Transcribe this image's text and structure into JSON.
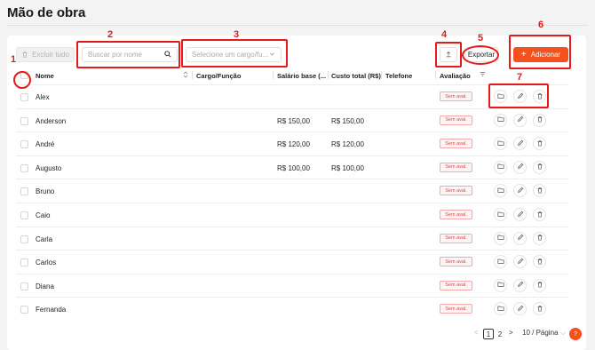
{
  "page": {
    "title": "Mão de obra"
  },
  "toolbar": {
    "delete_label": "Excluir tudo",
    "search_placeholder": "Buscar por nome",
    "role_placeholder": "Selecione um cargo/fu...",
    "export_label": "Exportar",
    "add_label": "Adicionar"
  },
  "table": {
    "columns": [
      "Nome",
      "Cargo/Função",
      "Salário base (...",
      "Custo total (R$)",
      "Telefone",
      "Avaliação"
    ],
    "rows": [
      {
        "name": "Alex",
        "role": "",
        "salary": "",
        "cost": "",
        "phone": "",
        "rating": "Sem aval."
      },
      {
        "name": "Anderson",
        "role": "",
        "salary": "R$ 150,00",
        "cost": "R$ 150,00",
        "phone": "",
        "rating": "Sem aval."
      },
      {
        "name": "André",
        "role": "",
        "salary": "R$ 120,00",
        "cost": "R$ 120,00",
        "phone": "",
        "rating": "Sem aval."
      },
      {
        "name": "Augusto",
        "role": "",
        "salary": "R$ 100,00",
        "cost": "R$ 100,00",
        "phone": "",
        "rating": "Sem aval."
      },
      {
        "name": "Bruno",
        "role": "",
        "salary": "",
        "cost": "",
        "phone": "",
        "rating": "Sem aval."
      },
      {
        "name": "Caio",
        "role": "",
        "salary": "",
        "cost": "",
        "phone": "",
        "rating": "Sem aval."
      },
      {
        "name": "Carla",
        "role": "",
        "salary": "",
        "cost": "",
        "phone": "",
        "rating": "Sem aval."
      },
      {
        "name": "Carlos",
        "role": "",
        "salary": "",
        "cost": "",
        "phone": "",
        "rating": "Sem aval."
      },
      {
        "name": "Diana",
        "role": "",
        "salary": "",
        "cost": "",
        "phone": "",
        "rating": "Sem aval."
      },
      {
        "name": "Fernanda",
        "role": "",
        "salary": "",
        "cost": "",
        "phone": "",
        "rating": "Sem aval."
      }
    ]
  },
  "pagination": {
    "prev": "<",
    "pages": [
      "1",
      "2"
    ],
    "current": "1",
    "next": ">",
    "page_size": "10 / Página"
  },
  "annotations": [
    "1",
    "2",
    "3",
    "4",
    "5",
    "6",
    "7"
  ],
  "colors": {
    "accent": "#f4511e",
    "annotation": "#e51b1b",
    "badge_text": "#d34a4a"
  }
}
